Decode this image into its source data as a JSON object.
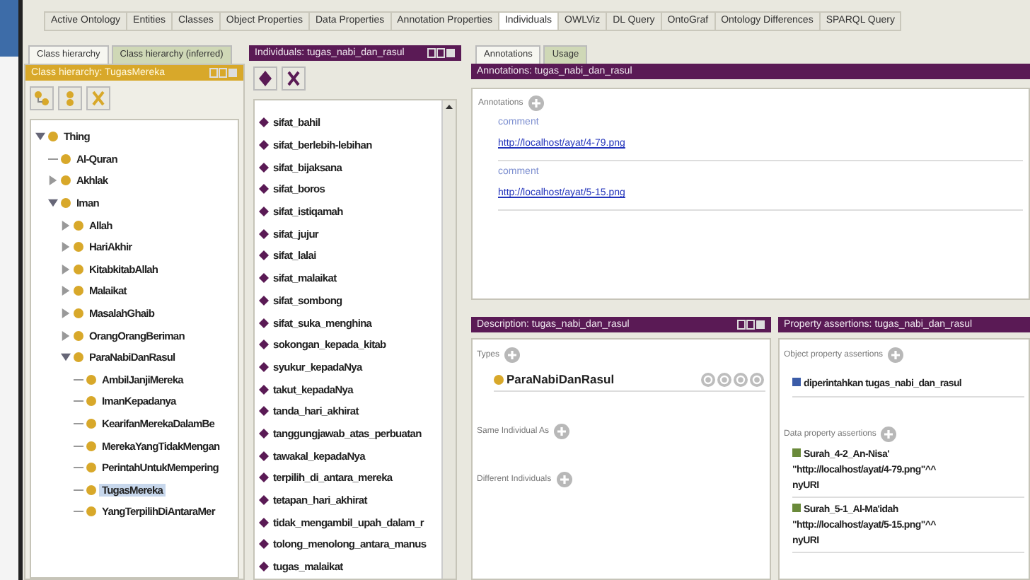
{
  "tabs": [
    {
      "label": "Active Ontology",
      "selected": false
    },
    {
      "label": "Entities",
      "selected": false
    },
    {
      "label": "Classes",
      "selected": false
    },
    {
      "label": "Object Properties",
      "selected": false
    },
    {
      "label": "Data Properties",
      "selected": false
    },
    {
      "label": "Annotation Properties",
      "selected": false
    },
    {
      "label": "Individuals",
      "selected": true
    },
    {
      "label": "OWLViz",
      "selected": false
    },
    {
      "label": "DL Query",
      "selected": false
    },
    {
      "label": "OntoGraf",
      "selected": false
    },
    {
      "label": "Ontology Differences",
      "selected": false
    },
    {
      "label": "SPARQL Query",
      "selected": false
    }
  ],
  "class_panel": {
    "tabs": [
      {
        "label": "Class hierarchy",
        "selected": true
      },
      {
        "label": "Class hierarchy (inferred)",
        "selected": false
      }
    ],
    "header": "Class hierarchy: TugasMereka",
    "tree": [
      {
        "label": "Thing",
        "kind": "branch",
        "expanded": true,
        "selected": false,
        "children": [
          {
            "label": "Al-Quran",
            "kind": "leaf",
            "expanded": false,
            "selected": false
          },
          {
            "label": "Akhlak",
            "kind": "branch",
            "expanded": false,
            "selected": false
          },
          {
            "label": "Iman",
            "kind": "branch",
            "expanded": true,
            "selected": false,
            "children": [
              {
                "label": "Allah",
                "kind": "branch",
                "expanded": false,
                "selected": false
              },
              {
                "label": "HariAkhir",
                "kind": "branch",
                "expanded": false,
                "selected": false
              },
              {
                "label": "KitabkitabAllah",
                "kind": "branch",
                "expanded": false,
                "selected": false
              },
              {
                "label": "Malaikat",
                "kind": "branch",
                "expanded": false,
                "selected": false
              },
              {
                "label": "MasalahGhaib",
                "kind": "branch",
                "expanded": false,
                "selected": false
              },
              {
                "label": "OrangOrangBeriman",
                "kind": "branch",
                "expanded": false,
                "selected": false
              },
              {
                "label": "ParaNabiDanRasul",
                "kind": "branch",
                "expanded": true,
                "selected": false,
                "children": [
                  {
                    "label": "AmbilJanjiMereka",
                    "kind": "leaf",
                    "expanded": false,
                    "selected": false
                  },
                  {
                    "label": "ImanKepadanya",
                    "kind": "leaf",
                    "expanded": false,
                    "selected": false
                  },
                  {
                    "label": "KearifanMerekaDalamBe",
                    "kind": "leaf",
                    "expanded": false,
                    "selected": false
                  },
                  {
                    "label": "MerekaYangTidakMengan",
                    "kind": "leaf",
                    "expanded": false,
                    "selected": false
                  },
                  {
                    "label": "PerintahUntukMempering",
                    "kind": "leaf",
                    "expanded": false,
                    "selected": false
                  },
                  {
                    "label": "TugasMereka",
                    "kind": "leaf",
                    "expanded": false,
                    "selected": true
                  },
                  {
                    "label": "YangTerpilihDiAntaraMer",
                    "kind": "leaf",
                    "expanded": false,
                    "selected": false
                  }
                ]
              }
            ]
          }
        ]
      }
    ]
  },
  "individuals_panel": {
    "header": "Individuals: tugas_nabi_dan_rasul",
    "items": [
      "sifat_bahil",
      "sifat_berlebih-lebihan",
      "sifat_bijaksana",
      "sifat_boros",
      "sifat_istiqamah",
      "sifat_jujur",
      "sifat_lalai",
      "sifat_malaikat",
      "sifat_sombong",
      "sifat_suka_menghina",
      "sokongan_kepada_kitab",
      "syukur_kepadaNya",
      "takut_kepadaNya",
      "tanda_hari_akhirat",
      "tanggungjawab_atas_perbuatan",
      "tawakal_kepadaNya",
      "terpilih_di_antara_mereka",
      "tetapan_hari_akhirat",
      "tidak_mengambil_upah_dalam_r",
      "tolong_menolong_antara_manus",
      "tugas_malaikat"
    ]
  },
  "annotations_panel": {
    "tabs": [
      {
        "label": "Annotations",
        "selected": true
      },
      {
        "label": "Usage",
        "selected": false
      }
    ],
    "header": "Annotations: tugas_nabi_dan_rasul",
    "section": "Annotations",
    "items": [
      {
        "property": "comment",
        "value": "http://localhost/ayat/4-79.png"
      },
      {
        "property": "comment",
        "value": "http://localhost/ayat/5-15.png"
      }
    ]
  },
  "description_panel": {
    "header": "Description: tugas_nabi_dan_rasul",
    "sections": [
      {
        "title": "Types",
        "items": [
          "ParaNabiDanRasul"
        ]
      },
      {
        "title": "Same Individual As"
      },
      {
        "title": "Different Individuals"
      }
    ]
  },
  "property_panel": {
    "header": "Property assertions: tugas_nabi_dan_rasul",
    "object_section": "Object property assertions",
    "object_items": [
      {
        "property": "diperintahkan",
        "value": "tugas_nabi_dan_rasul"
      }
    ],
    "data_section": "Data property assertions",
    "data_items": [
      {
        "property": "Surah_4-2_An-Nisa'",
        "value": "\"http://localhost/ayat/4-79.png\"^^",
        "type": "nyURI"
      },
      {
        "property": "Surah_5-1_Al-Ma'idah",
        "value": "\"http://localhost/ayat/5-15.png\"^^",
        "type": "nyURI"
      }
    ]
  }
}
